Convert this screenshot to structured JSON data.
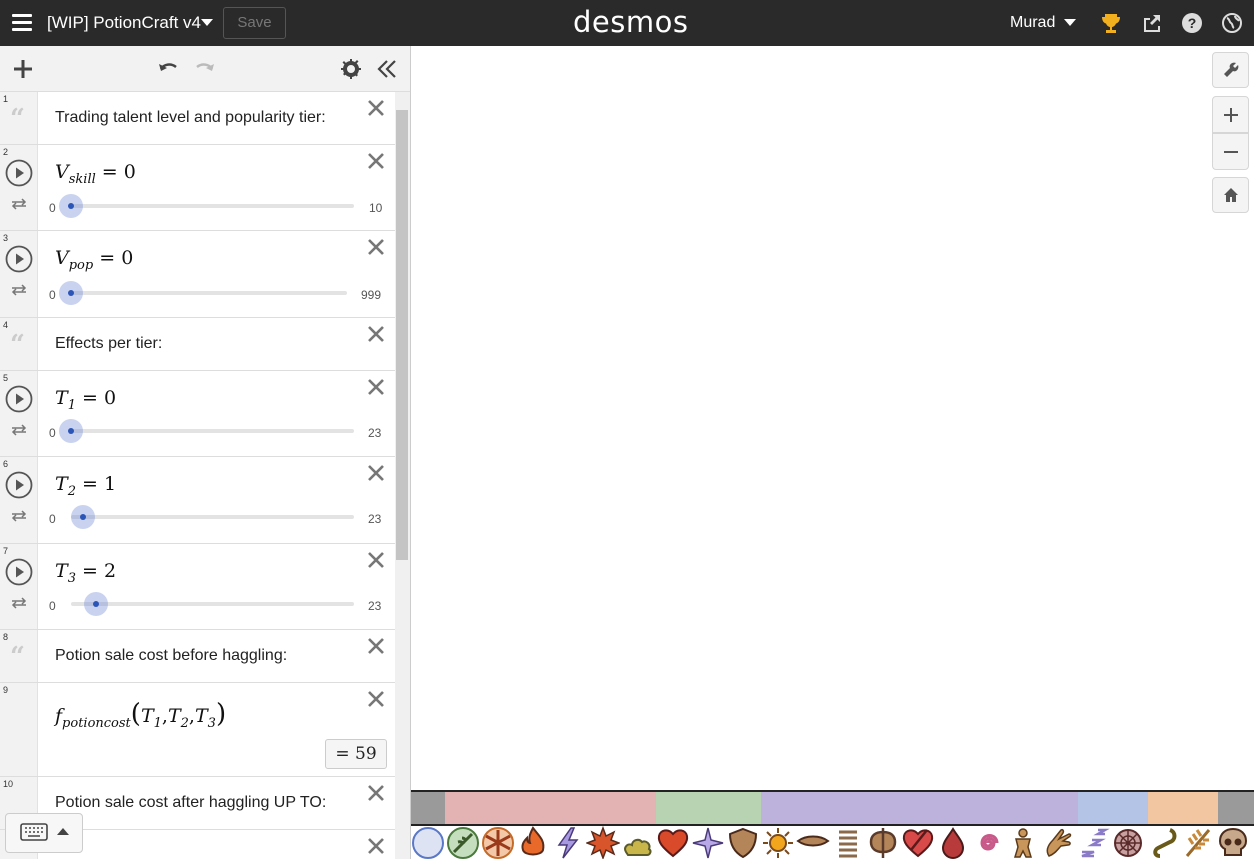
{
  "app": {
    "document_title": "[WIP] PotionCraft v4",
    "save_label": "Save",
    "logo": "desmos",
    "user_name": "Murad"
  },
  "expressions": [
    {
      "num": "1",
      "type": "note",
      "text": "Trading talent level and popularity tier:"
    },
    {
      "num": "2",
      "type": "slider",
      "var": "V",
      "sub": "skill",
      "value": "0",
      "min": "0",
      "max": "10",
      "fraction": 0.0
    },
    {
      "num": "3",
      "type": "slider",
      "var": "V",
      "sub": "pop",
      "value": "0",
      "min": "0",
      "max": "999",
      "fraction": 0.0
    },
    {
      "num": "4",
      "type": "note",
      "text": "Effects per tier:"
    },
    {
      "num": "5",
      "type": "slider",
      "var": "T",
      "sub": "1",
      "value": "0",
      "min": "0",
      "max": "23",
      "fraction": 0.0
    },
    {
      "num": "6",
      "type": "slider",
      "var": "T",
      "sub": "2",
      "value": "1",
      "min": "0",
      "max": "23",
      "fraction": 0.043
    },
    {
      "num": "7",
      "type": "slider",
      "var": "T",
      "sub": "3",
      "value": "2",
      "min": "0",
      "max": "23",
      "fraction": 0.087
    },
    {
      "num": "8",
      "type": "note",
      "text": "Potion sale cost before haggling:"
    },
    {
      "num": "9",
      "type": "function",
      "fname": "f",
      "fsub": "potioncost",
      "args": [
        "T",
        "T",
        "T"
      ],
      "argsubs": [
        "1",
        "2",
        "3"
      ],
      "result": "59",
      "equals": "="
    },
    {
      "num": "10",
      "type": "note",
      "text": "Potion sale cost after haggling UP TO:"
    }
  ],
  "colors": {
    "topbar": "#2a2a2a",
    "slider_knob": "#2c55b8",
    "segments": [
      "#9a9a9a",
      "#e3b3b3",
      "#b7d3b1",
      "#bdb2dc",
      "#b3c4e6",
      "#f3c6a2",
      "#9a9a9a"
    ]
  },
  "effect_icons": [
    "circle-icon",
    "herb-icon",
    "snowflake-icon",
    "fire-icon",
    "lightning-icon",
    "explosion-icon",
    "poison-cloud-icon",
    "heart-icon",
    "sparkle-icon",
    "shield-icon",
    "sun-icon",
    "eye-icon",
    "spring-icon",
    "axe-icon",
    "broken-heart-icon",
    "blood-drop-icon",
    "spiral-icon",
    "gingerbread-icon",
    "hand-icon",
    "sleep-icon",
    "web-icon",
    "hook-icon",
    "wheat-icon",
    "skull-icon"
  ]
}
